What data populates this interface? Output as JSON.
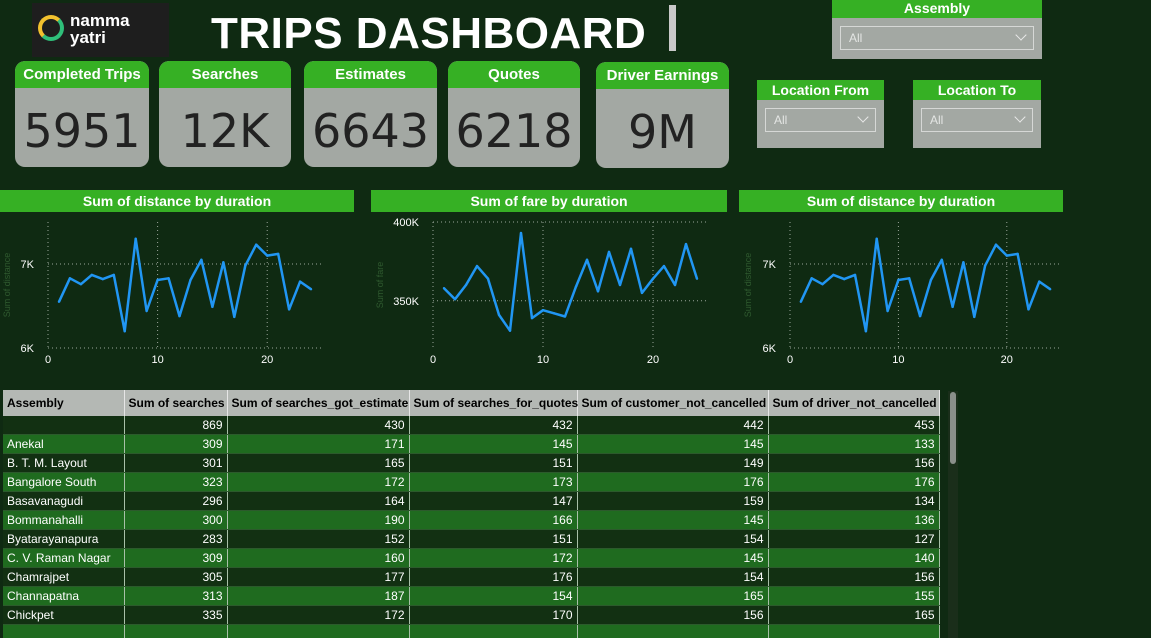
{
  "header": {
    "logo_line1": "namma",
    "logo_line2": "yatri",
    "title": "TRIPS DASHBOARD"
  },
  "kpis": [
    {
      "label": "Completed Trips",
      "value": "5951"
    },
    {
      "label": "Searches",
      "value": "12K"
    },
    {
      "label": "Estimates",
      "value": "6643"
    },
    {
      "label": "Quotes",
      "value": "6218"
    },
    {
      "label": "Driver Earnings",
      "value": "9M"
    }
  ],
  "slicers": {
    "assembly": {
      "label": "Assembly",
      "value": "All"
    },
    "location_from": {
      "label": "Location From",
      "value": "All"
    },
    "location_to": {
      "label": "Location To",
      "value": "All"
    }
  },
  "colors": {
    "accent_green": "#36b024",
    "background": "#0f2a12",
    "line": "#2196f3"
  },
  "chart_data": [
    {
      "type": "line",
      "title": "Sum of distance by duration",
      "ylabel": "Sum of distance",
      "x": [
        1,
        2,
        3,
        4,
        5,
        6,
        7,
        8,
        9,
        10,
        11,
        12,
        13,
        14,
        15,
        16,
        17,
        18,
        19,
        20,
        21,
        22,
        23,
        24
      ],
      "series": [
        {
          "values": [
            6550,
            6830,
            6760,
            6870,
            6820,
            6870,
            6200,
            7300,
            6440,
            6810,
            6830,
            6380,
            6810,
            7050,
            6490,
            7020,
            6370,
            6980,
            7230,
            7100,
            7120,
            6460,
            6790,
            6700
          ]
        }
      ],
      "ylim": [
        6000,
        7500
      ],
      "yticks": [
        "7K",
        "6K"
      ],
      "xticks": [
        "0",
        "10",
        "20"
      ],
      "xlim": [
        0,
        25
      ]
    },
    {
      "type": "line",
      "title": "Sum of fare by duration",
      "ylabel": "Sum of fare",
      "x": [
        1,
        2,
        3,
        4,
        5,
        6,
        7,
        8,
        9,
        10,
        11,
        12,
        13,
        14,
        15,
        16,
        17,
        18,
        19,
        20,
        21,
        22,
        23,
        24
      ],
      "series": [
        {
          "values": [
            358000,
            351000,
            360000,
            372000,
            364000,
            341000,
            331000,
            393000,
            339000,
            344000,
            342000,
            340000,
            359000,
            376000,
            356000,
            381000,
            360000,
            383000,
            355000,
            364000,
            372000,
            360000,
            386000,
            364000
          ]
        }
      ],
      "ylim": [
        320000,
        400000
      ],
      "yticks": [
        "400K",
        "350K"
      ],
      "xticks": [
        "0",
        "10",
        "20"
      ],
      "xlim": [
        0,
        25
      ]
    },
    {
      "type": "line",
      "title": "Sum of distance by duration",
      "ylabel": "Sum of distance",
      "x": [
        1,
        2,
        3,
        4,
        5,
        6,
        7,
        8,
        9,
        10,
        11,
        12,
        13,
        14,
        15,
        16,
        17,
        18,
        19,
        20,
        21,
        22,
        23,
        24
      ],
      "series": [
        {
          "values": [
            6550,
            6830,
            6760,
            6870,
            6820,
            6870,
            6200,
            7300,
            6440,
            6810,
            6830,
            6380,
            6810,
            7050,
            6490,
            7020,
            6370,
            6980,
            7230,
            7100,
            7120,
            6460,
            6790,
            6700
          ]
        }
      ],
      "ylim": [
        6000,
        7500
      ],
      "yticks": [
        "7K",
        "6K"
      ],
      "xticks": [
        "0",
        "10",
        "20"
      ],
      "xlim": [
        0,
        25
      ]
    }
  ],
  "table": {
    "columns": [
      "Assembly",
      "Sum of searches",
      "Sum of searches_got_estimate",
      "Sum of searches_for_quotes",
      "Sum of customer_not_cancelled",
      "Sum of driver_not_cancelled"
    ],
    "rows": [
      [
        "",
        "869",
        "430",
        "432",
        "442",
        "453"
      ],
      [
        "Anekal",
        "309",
        "171",
        "145",
        "145",
        "133"
      ],
      [
        "B. T. M. Layout",
        "301",
        "165",
        "151",
        "149",
        "156"
      ],
      [
        "Bangalore South",
        "323",
        "172",
        "173",
        "176",
        "176"
      ],
      [
        "Basavanagudi",
        "296",
        "164",
        "147",
        "159",
        "134"
      ],
      [
        "Bommanahalli",
        "300",
        "190",
        "166",
        "145",
        "136"
      ],
      [
        "Byatarayanapura",
        "283",
        "152",
        "151",
        "154",
        "127"
      ],
      [
        "C. V. Raman Nagar",
        "309",
        "160",
        "172",
        "145",
        "140"
      ],
      [
        "Chamrajpet",
        "305",
        "177",
        "176",
        "154",
        "156"
      ],
      [
        "Channapatna",
        "313",
        "187",
        "154",
        "165",
        "155"
      ],
      [
        "Chickpet",
        "335",
        "172",
        "170",
        "156",
        "165"
      ],
      [
        "",
        "",
        "",
        "",
        "",
        ""
      ]
    ]
  }
}
